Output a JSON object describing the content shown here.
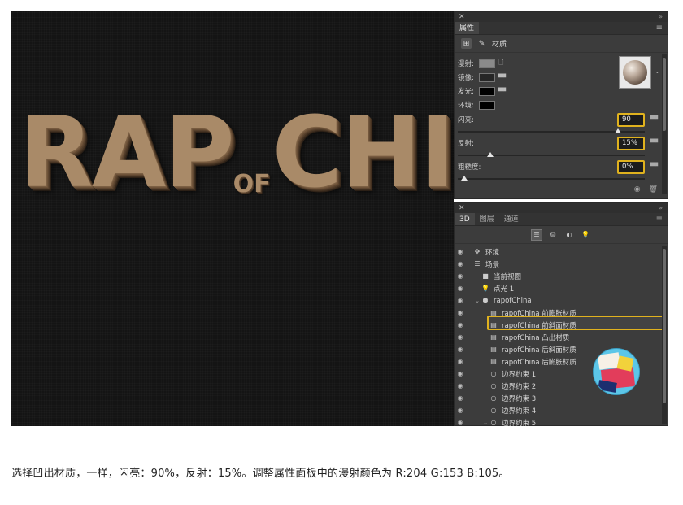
{
  "canvas": {
    "title_big_1": "RAP",
    "title_small": "OF",
    "title_big_2": "CHI"
  },
  "properties_panel": {
    "tab": "属性",
    "mode_label": "材质",
    "materials": [
      {
        "label": "漫射:",
        "color": "#8a8a8a"
      },
      {
        "label": "镜像:",
        "color": "#262626"
      },
      {
        "label": "发光:",
        "color": "#000000"
      },
      {
        "label": "环境:",
        "color": "#000000"
      }
    ],
    "sliders": [
      {
        "label": "闪亮:",
        "value": "90",
        "level": 0.9
      },
      {
        "label": "反射:",
        "value": "15%",
        "level": 0.15
      },
      {
        "label": "粗糙度:",
        "value": "0%",
        "level": 0.0
      }
    ]
  },
  "layers_panel": {
    "tabs": [
      "3D",
      "图层",
      "通道"
    ],
    "items": [
      {
        "label": "环境",
        "icon": "environment-icon",
        "indent": 0,
        "arrow": ""
      },
      {
        "label": "场景",
        "icon": "scene-icon",
        "indent": 0,
        "arrow": ""
      },
      {
        "label": "当前视图",
        "icon": "camera-icon",
        "indent": 1,
        "arrow": ""
      },
      {
        "label": "点光 1",
        "icon": "light-bulb-icon",
        "indent": 1,
        "arrow": ""
      },
      {
        "label": "rapofChina",
        "icon": "mesh-icon",
        "indent": 1,
        "arrow": "v"
      },
      {
        "label": "rapofChina 前膨胀材质",
        "icon": "material-icon",
        "indent": 2,
        "arrow": ""
      },
      {
        "label": "rapofChina 前斜面材质",
        "icon": "material-icon",
        "indent": 2,
        "arrow": ""
      },
      {
        "label": "rapofChina 凸出材质",
        "icon": "material-icon",
        "indent": 2,
        "arrow": ""
      },
      {
        "label": "rapofChina 后斜面材质",
        "icon": "material-icon",
        "indent": 2,
        "arrow": ""
      },
      {
        "label": "rapofChina 后膨胀材质",
        "icon": "material-icon",
        "indent": 2,
        "arrow": ""
      },
      {
        "label": "边界约束 1",
        "icon": "constraint-icon",
        "indent": 2,
        "arrow": ""
      },
      {
        "label": "边界约束 2",
        "icon": "constraint-icon",
        "indent": 2,
        "arrow": ""
      },
      {
        "label": "边界约束 3",
        "icon": "constraint-icon",
        "indent": 2,
        "arrow": ""
      },
      {
        "label": "边界约束 4",
        "icon": "constraint-icon",
        "indent": 2,
        "arrow": ""
      },
      {
        "label": "边界约束 5",
        "icon": "constraint-icon",
        "indent": 2,
        "arrow": "v"
      }
    ],
    "selected_index": 6
  },
  "caption": "选择凹出材质，一样，闪亮：90%，反射：15%。调整属性面板中的漫射颜色为 R:204 G:153 B:105。",
  "accent_color": "#e0b21e"
}
